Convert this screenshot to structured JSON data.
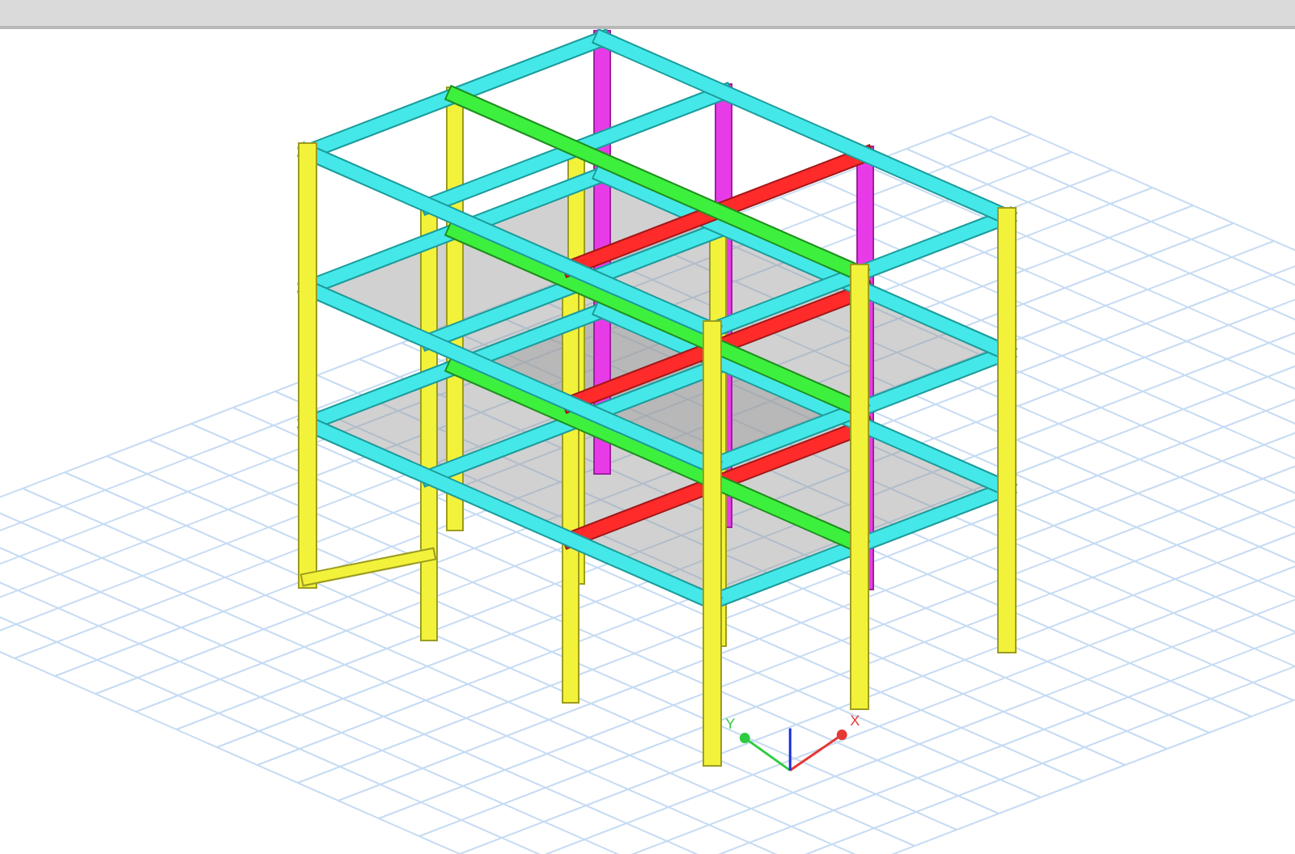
{
  "axes": [
    {
      "label": "Y",
      "color": "#2ecc40"
    },
    {
      "label": "X",
      "color": "#e53935"
    }
  ]
}
